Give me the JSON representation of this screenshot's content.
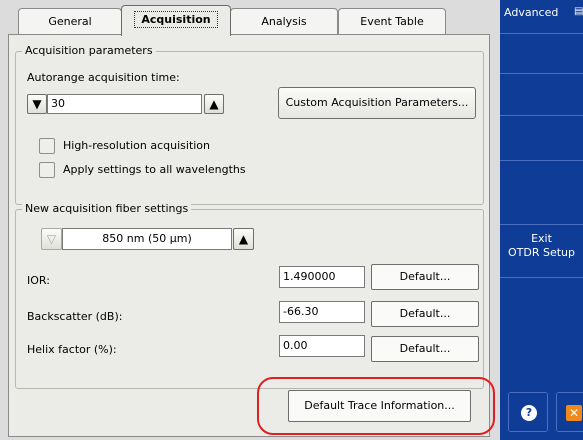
{
  "tabs": [
    {
      "label": "General"
    },
    {
      "label": "Acquisition"
    },
    {
      "label": "Analysis"
    },
    {
      "label": "Event Table"
    }
  ],
  "acquisition_parameters": {
    "legend": "Acquisition parameters",
    "autorange_label": "Autorange acquisition time:",
    "time_value": "30",
    "custom_button": "Custom Acquisition Parameters...",
    "high_res_label": "High-resolution acquisition",
    "apply_all_label": "Apply settings to all wavelengths"
  },
  "fiber_settings": {
    "legend": "New acquisition fiber settings",
    "fiber_value": "850 nm (50 μm)",
    "ior_label": "IOR:",
    "ior_value": "1.490000",
    "backscatter_label": "Backscatter (dB):",
    "backscatter_value": "-66.30",
    "helix_label": "Helix factor (%):",
    "helix_value": "0.00",
    "default_label": "Default..."
  },
  "default_trace_button": "Default Trace Information...",
  "sidebar": {
    "advanced_label": "Advanced",
    "exit_line1": "Exit",
    "exit_line2": "OTDR Setup",
    "help_icon": "question-icon",
    "close_icon": "close-icon"
  },
  "colors": {
    "sidebar_bg": "#0f3c97",
    "highlight": "#e02020",
    "close_icon": "#f08a1c"
  }
}
